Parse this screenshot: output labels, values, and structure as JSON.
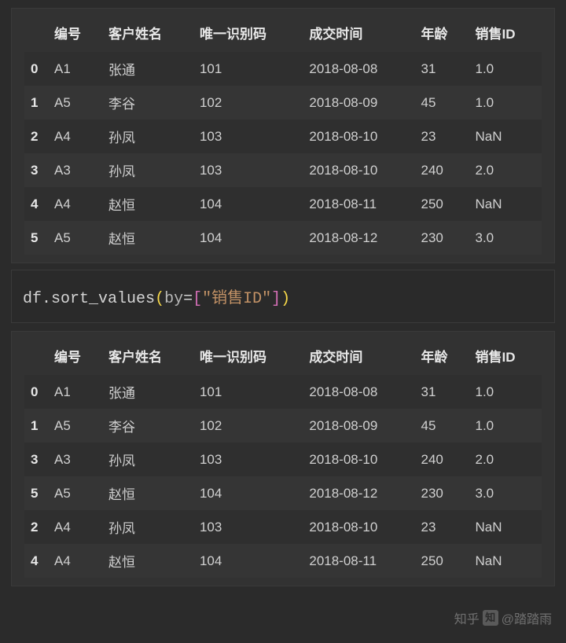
{
  "table1": {
    "headers": [
      "",
      "编号",
      "客户姓名",
      "唯一识别码",
      "成交时间",
      "年龄",
      "销售ID"
    ],
    "rows": [
      {
        "idx": "0",
        "c1": "A1",
        "c2": "张通",
        "c3": "101",
        "c4": "2018-08-08",
        "c5": "31",
        "c6": "1.0"
      },
      {
        "idx": "1",
        "c1": "A5",
        "c2": "李谷",
        "c3": "102",
        "c4": "2018-08-09",
        "c5": "45",
        "c6": "1.0"
      },
      {
        "idx": "2",
        "c1": "A4",
        "c2": "孙凤",
        "c3": "103",
        "c4": "2018-08-10",
        "c5": "23",
        "c6": "NaN"
      },
      {
        "idx": "3",
        "c1": "A3",
        "c2": "孙凤",
        "c3": "103",
        "c4": "2018-08-10",
        "c5": "240",
        "c6": "2.0"
      },
      {
        "idx": "4",
        "c1": "A4",
        "c2": "赵恒",
        "c3": "104",
        "c4": "2018-08-11",
        "c5": "250",
        "c6": "NaN"
      },
      {
        "idx": "5",
        "c1": "A5",
        "c2": "赵恒",
        "c3": "104",
        "c4": "2018-08-12",
        "c5": "230",
        "c6": "3.0"
      }
    ]
  },
  "code": {
    "obj": "df",
    "method": "sort_values",
    "by_kw": "by",
    "arg": "\"销售ID\""
  },
  "table2": {
    "headers": [
      "",
      "编号",
      "客户姓名",
      "唯一识别码",
      "成交时间",
      "年龄",
      "销售ID"
    ],
    "rows": [
      {
        "idx": "0",
        "c1": "A1",
        "c2": "张通",
        "c3": "101",
        "c4": "2018-08-08",
        "c5": "31",
        "c6": "1.0"
      },
      {
        "idx": "1",
        "c1": "A5",
        "c2": "李谷",
        "c3": "102",
        "c4": "2018-08-09",
        "c5": "45",
        "c6": "1.0"
      },
      {
        "idx": "3",
        "c1": "A3",
        "c2": "孙凤",
        "c3": "103",
        "c4": "2018-08-10",
        "c5": "240",
        "c6": "2.0"
      },
      {
        "idx": "5",
        "c1": "A5",
        "c2": "赵恒",
        "c3": "104",
        "c4": "2018-08-12",
        "c5": "230",
        "c6": "3.0"
      },
      {
        "idx": "2",
        "c1": "A4",
        "c2": "孙凤",
        "c3": "103",
        "c4": "2018-08-10",
        "c5": "23",
        "c6": "NaN"
      },
      {
        "idx": "4",
        "c1": "A4",
        "c2": "赵恒",
        "c3": "104",
        "c4": "2018-08-11",
        "c5": "250",
        "c6": "NaN"
      }
    ]
  },
  "watermark": {
    "brand": "知乎",
    "author": "@踏踏雨"
  },
  "chart_data": {
    "type": "table",
    "tables": [
      {
        "name": "original",
        "columns": [
          "编号",
          "客户姓名",
          "唯一识别码",
          "成交时间",
          "年龄",
          "销售ID"
        ],
        "index": [
          0,
          1,
          2,
          3,
          4,
          5
        ],
        "data": [
          [
            "A1",
            "张通",
            101,
            "2018-08-08",
            31,
            1.0
          ],
          [
            "A5",
            "李谷",
            102,
            "2018-08-09",
            45,
            1.0
          ],
          [
            "A4",
            "孙凤",
            103,
            "2018-08-10",
            23,
            null
          ],
          [
            "A3",
            "孙凤",
            103,
            "2018-08-10",
            240,
            2.0
          ],
          [
            "A4",
            "赵恒",
            104,
            "2018-08-11",
            250,
            null
          ],
          [
            "A5",
            "赵恒",
            104,
            "2018-08-12",
            230,
            3.0
          ]
        ]
      },
      {
        "name": "sorted_by_销售ID",
        "columns": [
          "编号",
          "客户姓名",
          "唯一识别码",
          "成交时间",
          "年龄",
          "销售ID"
        ],
        "index": [
          0,
          1,
          3,
          5,
          2,
          4
        ],
        "data": [
          [
            "A1",
            "张通",
            101,
            "2018-08-08",
            31,
            1.0
          ],
          [
            "A5",
            "李谷",
            102,
            "2018-08-09",
            45,
            1.0
          ],
          [
            "A3",
            "孙凤",
            103,
            "2018-08-10",
            240,
            2.0
          ],
          [
            "A5",
            "赵恒",
            104,
            "2018-08-12",
            230,
            3.0
          ],
          [
            "A4",
            "孙凤",
            103,
            "2018-08-10",
            23,
            null
          ],
          [
            "A4",
            "赵恒",
            104,
            "2018-08-11",
            250,
            null
          ]
        ]
      }
    ]
  }
}
